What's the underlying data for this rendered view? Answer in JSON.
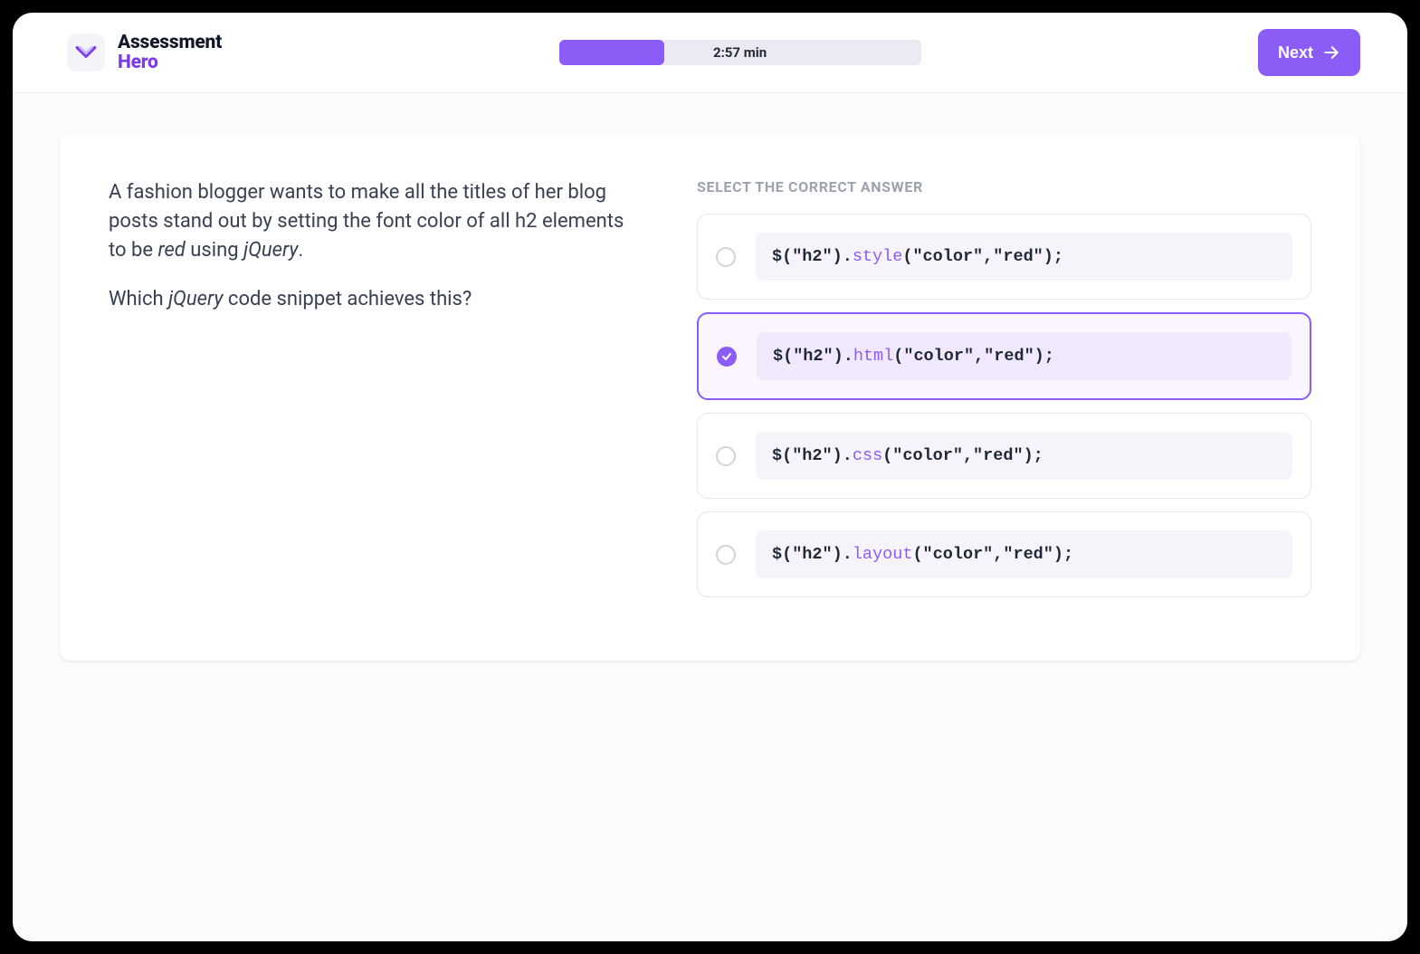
{
  "header": {
    "logo": {
      "line1": "Assessment",
      "line2": "Hero"
    },
    "timer": "2:57 min",
    "progress_percent": 29,
    "next_label": "Next"
  },
  "question": {
    "para1_pre": "A fashion blogger wants to make all the titles of her blog posts stand out by setting the font color of all h2 elements to be ",
    "para1_em": "red",
    "para1_mid": " using ",
    "para1_em2": "jQuery",
    "para1_post": ".",
    "para2_pre": "Which ",
    "para2_em": "jQuery",
    "para2_post": " code snippet achieves this?"
  },
  "answers": {
    "heading": "SELECT THE CORRECT ANSWER",
    "selected_index": 1,
    "options": [
      {
        "prefix": "$(\"h2\").",
        "fn": "style",
        "args": "(\"color\",\"red\");"
      },
      {
        "prefix": "$(\"h2\").",
        "fn": "html",
        "args": "(\"color\",\"red\");"
      },
      {
        "prefix": "$(\"h2\").",
        "fn": "css",
        "args": "(\"color\",\"red\");"
      },
      {
        "prefix": "$(\"h2\").",
        "fn": "layout",
        "args": "(\"color\",\"red\");"
      }
    ]
  }
}
